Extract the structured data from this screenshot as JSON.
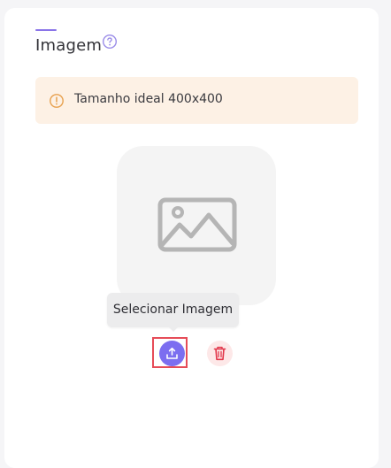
{
  "section": {
    "title": "Imagem",
    "help_icon": "question-circle-icon"
  },
  "alert": {
    "icon": "warning-circle-icon",
    "text": "Tamanho ideal 400x400"
  },
  "image_preview": {
    "icon": "image-placeholder-icon"
  },
  "tooltip": {
    "text": "Selecionar Imagem"
  },
  "actions": {
    "upload_icon": "upload-icon",
    "delete_icon": "trash-icon"
  },
  "colors": {
    "accent": "#7c6ef0",
    "alert_background": "#fdf1e5",
    "alert_icon": "#e7a04d",
    "delete": "#e2364a"
  }
}
